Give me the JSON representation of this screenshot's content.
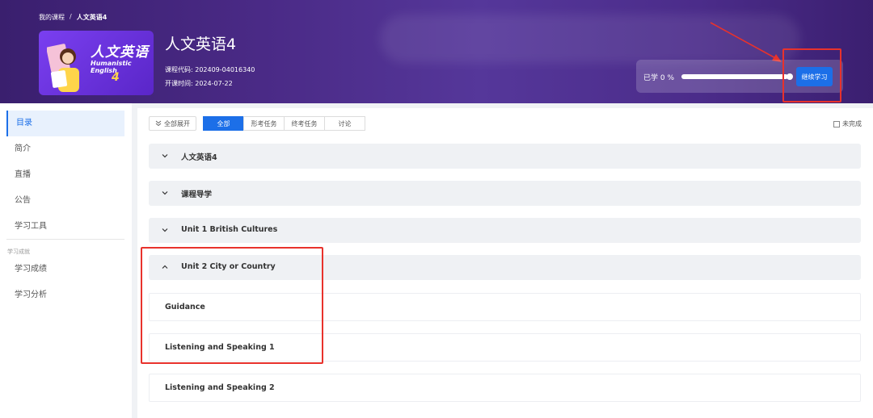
{
  "breadcrumb": {
    "root": "我的课程",
    "sep": "/",
    "current": "人文英语4"
  },
  "cover": {
    "title": "人文英语",
    "subtitle": "Humanistic English",
    "number": "4"
  },
  "course": {
    "title": "人文英语4",
    "code_label": "课程代码: 202409-04016340",
    "start_label": "开课时间: 2024-07-22"
  },
  "progress": {
    "label": "已学 0 %",
    "percent": 0,
    "continue_label": "继续学习"
  },
  "sidebar": {
    "items": [
      {
        "label": "目录",
        "active": true
      },
      {
        "label": "简介"
      },
      {
        "label": "直播"
      },
      {
        "label": "公告"
      },
      {
        "label": "学习工具"
      }
    ],
    "section_title": "学习成就",
    "section_items": [
      {
        "label": "学习成绩"
      },
      {
        "label": "学习分析"
      }
    ]
  },
  "filters": {
    "expand_label": "全部展开",
    "tabs": [
      {
        "label": "全部",
        "active": true
      },
      {
        "label": "形考任务"
      },
      {
        "label": "终考任务"
      },
      {
        "label": "讨论"
      }
    ],
    "incomplete_label": "未完成"
  },
  "chapters": [
    {
      "title": "人文英语4",
      "expanded": false
    },
    {
      "title": "课程导学",
      "expanded": false
    },
    {
      "title": "Unit 1 British Cultures",
      "expanded": false
    },
    {
      "title": "Unit 2 City or Country",
      "expanded": true
    }
  ],
  "lessons": [
    {
      "title": "Guidance"
    },
    {
      "title": "Listening and Speaking 1"
    },
    {
      "title": "Listening and Speaking 2"
    }
  ],
  "colors": {
    "accent": "#1c6fe8",
    "annotation": "#e8322c",
    "header": "#4a2a86"
  }
}
